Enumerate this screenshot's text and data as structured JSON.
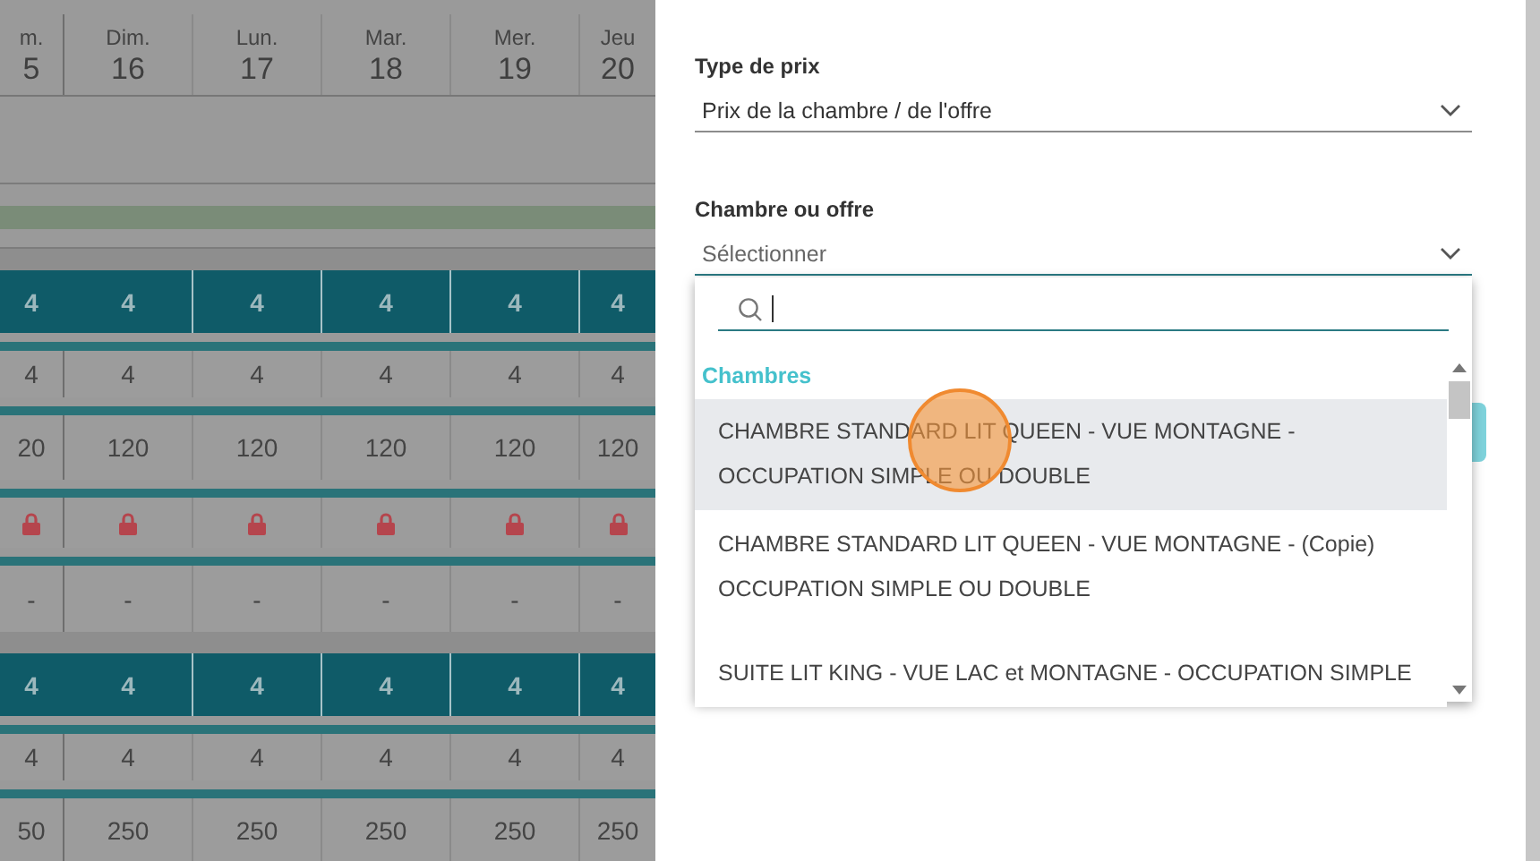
{
  "calendar": {
    "columns": [
      {
        "day": "m.",
        "date": "5"
      },
      {
        "day": "Dim.",
        "date": "16"
      },
      {
        "day": "Lun.",
        "date": "17"
      },
      {
        "day": "Mar.",
        "date": "18"
      },
      {
        "day": "Mer.",
        "date": "19"
      },
      {
        "day": "Jeu",
        "date": "20"
      }
    ],
    "rows": [
      {
        "kind": "empty"
      },
      {
        "kind": "bar",
        "color": "#7a8c78"
      },
      {
        "kind": "gap"
      },
      {
        "kind": "dark",
        "cells": [
          "4",
          "4",
          "4",
          "4",
          "4",
          "4"
        ]
      },
      {
        "kind": "count",
        "cells": [
          "4",
          "4",
          "4",
          "4",
          "4",
          "4"
        ]
      },
      {
        "kind": "price",
        "cells": [
          "20",
          "120",
          "120",
          "120",
          "120",
          "120"
        ]
      },
      {
        "kind": "lock",
        "locked": [
          true,
          true,
          true,
          true,
          true,
          true
        ]
      },
      {
        "kind": "dash",
        "cells": [
          "-",
          "-",
          "-",
          "-",
          "-",
          "-"
        ]
      },
      {
        "kind": "gap"
      },
      {
        "kind": "dark",
        "cells": [
          "4",
          "4",
          "4",
          "4",
          "4",
          "4"
        ]
      },
      {
        "kind": "count",
        "cells": [
          "4",
          "4",
          "4",
          "4",
          "4",
          "4"
        ]
      },
      {
        "kind": "price",
        "cells": [
          "50",
          "250",
          "250",
          "250",
          "250",
          "250"
        ]
      }
    ]
  },
  "form": {
    "fields": [
      {
        "label": "Type de prix",
        "value": "Prix de la chambre / de l'offre",
        "focused": false
      },
      {
        "label": "Chambre ou offre",
        "placeholder": "Sélectionner",
        "focused": true
      }
    ]
  },
  "dropdown": {
    "groups": [
      {
        "title": "Chambres",
        "options": [
          {
            "label": "CHAMBRE STANDARD LIT QUEEN - VUE MONTAGNE -\nOCCUPATION SIMPLE OU DOUBLE",
            "highlighted": true
          },
          {
            "label": "CHAMBRE STANDARD LIT QUEEN - VUE MONTAGNE - (Copie)\nOCCUPATION SIMPLE OU DOUBLE",
            "highlighted": false
          },
          {
            "label": "SUITE LIT KING - VUE LAC et MONTAGNE - OCCUPATION SIMPLE",
            "highlighted": false
          }
        ]
      }
    ]
  }
}
